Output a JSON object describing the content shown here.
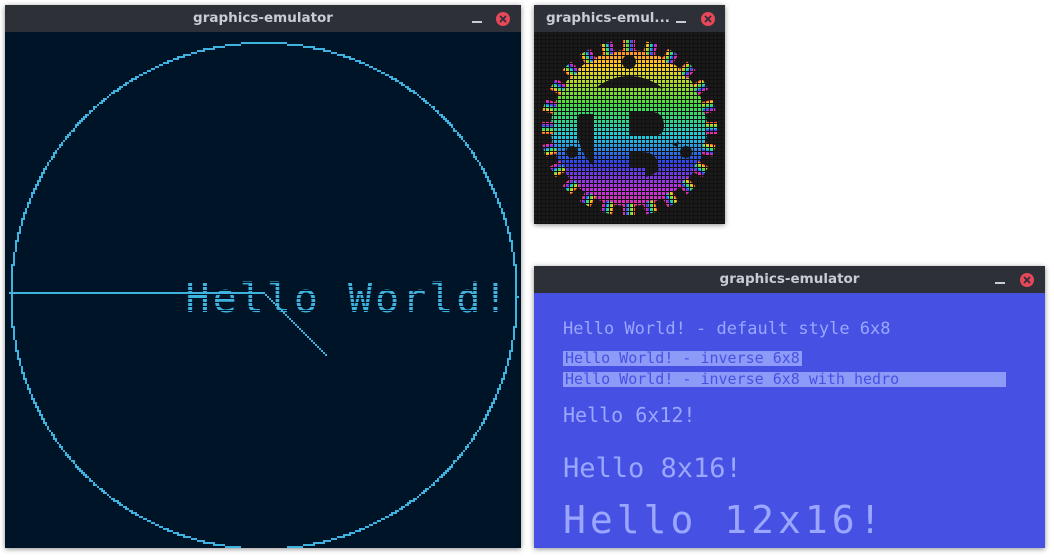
{
  "window_main": {
    "title": "graphics-emulator",
    "text": "Hello World!",
    "background": "#001428",
    "foreground": "#3fb3df"
  },
  "window_logo": {
    "title": "graphics-emul...",
    "background": "#111111"
  },
  "window_text": {
    "title": "graphics-emulator",
    "background": "#4651e3",
    "foreground": "#9aa6ff",
    "lines": [
      "Hello World! - default style 6x8",
      "Hello World! - inverse 6x8",
      "Hello World! - inverse 6x8 with hedro",
      "Hello 6x12!",
      "Hello 8x16!",
      "Hello 12x16!"
    ]
  },
  "icons": {
    "minimize": "minimize-icon",
    "close": "close-icon"
  },
  "colors": {
    "titlebar": "#2e3038",
    "title_text": "#c9cdd3",
    "close": "#e8475a"
  }
}
